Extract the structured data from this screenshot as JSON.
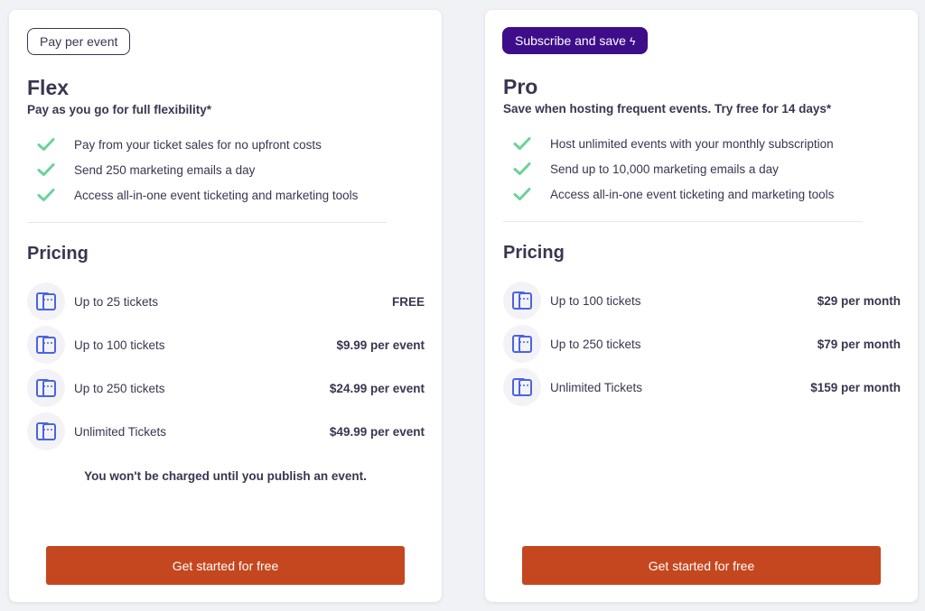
{
  "plans": [
    {
      "badge": "Pay per event",
      "name": "Flex",
      "subtitle": "Pay as you go for full flexibility*",
      "features": [
        "Pay from your ticket sales for no upfront costs",
        "Send 250 marketing emails a day",
        "Access all-in-one event ticketing and marketing tools"
      ],
      "pricing_title": "Pricing",
      "tiers": [
        {
          "label": "Up to 25 tickets",
          "price": "FREE"
        },
        {
          "label": "Up to 100 tickets",
          "price": "$9.99 per event"
        },
        {
          "label": "Up to 250 tickets",
          "price": "$24.99 per event"
        },
        {
          "label": "Unlimited Tickets",
          "price": "$49.99 per event"
        }
      ],
      "note": "You won't be charged until you publish an event.",
      "cta": "Get started for free"
    },
    {
      "badge": "Subscribe and save",
      "badge_icon": "lightning-bolt-icon",
      "name": "Pro",
      "subtitle": "Save when hosting frequent events. Try free for 14 days*",
      "features": [
        "Host unlimited events with your monthly subscription",
        "Send up to 10,000 marketing emails a day",
        "Access all-in-one event ticketing and marketing tools"
      ],
      "pricing_title": "Pricing",
      "tiers": [
        {
          "label": "Up to 100 tickets",
          "price": "$29 per month"
        },
        {
          "label": "Up to 250 tickets",
          "price": "$79 per month"
        },
        {
          "label": "Unlimited Tickets",
          "price": "$159 per month"
        }
      ],
      "cta": "Get started for free"
    }
  ],
  "colors": {
    "text": "#39364f",
    "check": "#6ad39a",
    "ticket_icon": "#4b63e0",
    "cta": "#c5471f",
    "pro_badge": "#3d0d8a"
  }
}
